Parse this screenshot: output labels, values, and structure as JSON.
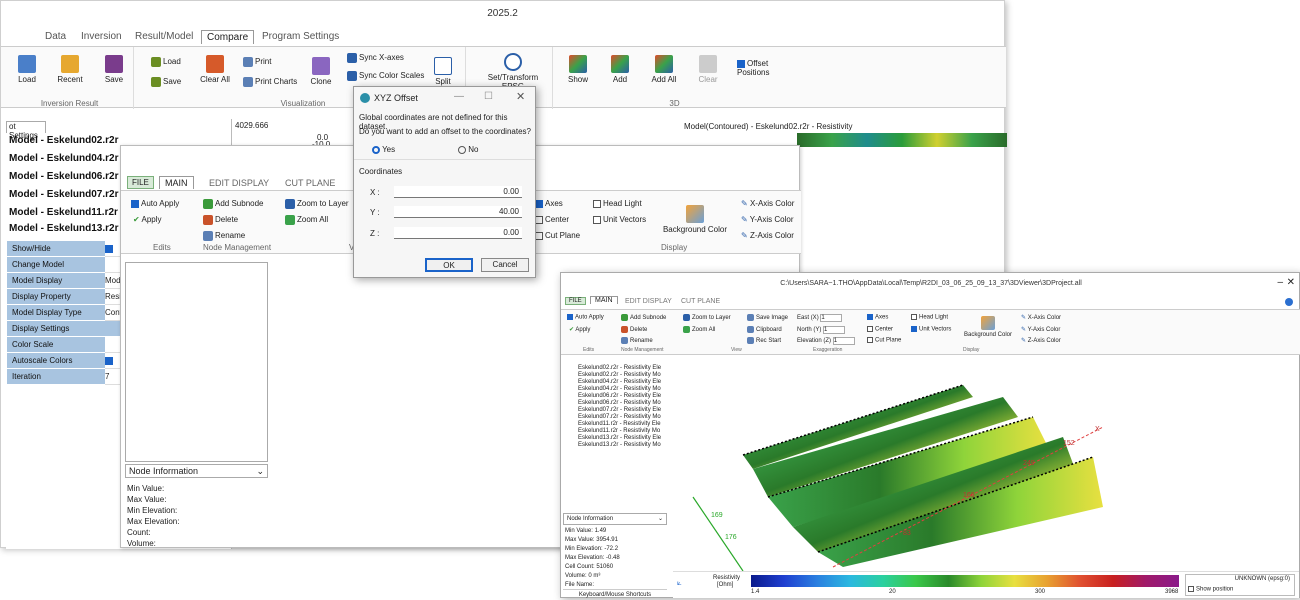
{
  "app": {
    "title": "2025.2"
  },
  "tabs": [
    "Data",
    "Inversion",
    "Result/Model",
    "Compare",
    "Program Settings"
  ],
  "ribbon": {
    "inversion_result": {
      "label": "Inversion Result",
      "load": "Load",
      "recent": "Recent",
      "save": "Save"
    },
    "visualization": {
      "label": "Visualization",
      "load": "Load",
      "save": "Save",
      "clear_all": "Clear All",
      "print": "Print",
      "print_charts": "Print Charts",
      "clone": "Clone",
      "sync_x": "Sync X-axes",
      "sync_color": "Sync Color Scales",
      "split": "Split"
    },
    "epsg": {
      "label": "Set/Transform EPSG"
    },
    "three_d": {
      "label": "3D",
      "show": "Show",
      "add": "Add",
      "add_all": "Add All",
      "clear": "Clear",
      "offset_positions": "Offset Positions"
    }
  },
  "plot": {
    "settings_tab": "ot Settings",
    "y_value": "4029.666",
    "y0": "0.0",
    "y1": "-10.0",
    "title": "Model(Contoured) - Eskelund02.r2r - Resistivity"
  },
  "models": [
    "Model - Eskelund02.r2r",
    "Model - Eskelund04.r2r",
    "Model - Eskelund06.r2r",
    "Model - Eskelund07.r2r",
    "Model - Eskelund11.r2r",
    "Model - Eskelund13.r2r"
  ],
  "properties": [
    {
      "name": "Show/Hide",
      "value": ""
    },
    {
      "name": "Change Model",
      "value": ""
    },
    {
      "name": "Model Display",
      "value": "Mod"
    },
    {
      "name": "Display Property",
      "value": "Resis"
    },
    {
      "name": "Model Display Type",
      "value": "Cont"
    },
    {
      "name": "Display Settings",
      "value": ""
    },
    {
      "name": "Color Scale",
      "value": ""
    },
    {
      "name": "Autoscale Colors",
      "value": ""
    },
    {
      "name": "Iteration",
      "value": "7"
    }
  ],
  "viewer1": {
    "tabs": [
      "FILE",
      "MAIN",
      "EDIT DISPLAY",
      "CUT PLANE"
    ],
    "auto_apply": "Auto Apply",
    "apply": "Apply",
    "edits": "Edits",
    "add_subnode": "Add Subnode",
    "delete": "Delete",
    "rename": "Rename",
    "node_mgmt": "Node Management",
    "zoom_layer": "Zoom to Layer",
    "zoom_all": "Zoom All",
    "view_short": "V",
    "axes": "Axes",
    "center": "Center",
    "cut_plane": "Cut Plane",
    "head_light": "Head Light",
    "unit_vectors": "Unit Vectors",
    "background_color": "Background Color",
    "display": "Display",
    "x_axis_color": "X-Axis Color",
    "y_axis_color": "Y-Axis Color",
    "z_axis_color": "Z-Axis Color",
    "node_info": "Node Information",
    "info": [
      "Min Value:",
      "Max Value:",
      "Min Elevation:",
      "Max Elevation:",
      "Count:",
      "Volume:"
    ]
  },
  "dialog": {
    "title": "XYZ Offset",
    "message1": "Global coordinates are not defined for this dataset.",
    "message2": "Do you want to add an offset to the coordinates?",
    "yes": "Yes",
    "no": "No",
    "coordinates": "Coordinates",
    "x_label": "X :",
    "y_label": "Y :",
    "z_label": "Z :",
    "x": "0.00",
    "y": "40.00",
    "z": "0.00",
    "ok": "OK",
    "cancel": "Cancel"
  },
  "viewer2": {
    "title": "C:\\Users\\SARA~1.THO\\AppData\\Local\\Temp\\R2DI_03_06_25_09_13_37\\3DViewer\\3DProject.all",
    "tabs": [
      "FILE",
      "MAIN",
      "EDIT DISPLAY",
      "CUT PLANE"
    ],
    "auto_apply": "Auto Apply",
    "apply": "Apply",
    "edits": "Edits",
    "add_subnode": "Add Subnode",
    "delete": "Delete",
    "rename": "Rename",
    "node_mgmt": "Node Management",
    "zoom_layer": "Zoom to Layer",
    "zoom_all": "Zoom All",
    "save_image": "Save Image",
    "clipboard": "Clipboard",
    "rec_start": "Rec Start",
    "view": "View",
    "east": "East",
    "north": "North",
    "elevation": "Elevation",
    "ex": "(X)",
    "ny": "(Y)",
    "ez": "(Z)",
    "one": "1",
    "exaggeration": "Exaggeration",
    "axes": "Axes",
    "center": "Center",
    "cut_plane": "Cut Plane",
    "head_light": "Head Light",
    "unit_vectors": "Unit Vectors",
    "background_color": "Background Color",
    "display": "Display",
    "x_axis_color": "X-Axis Color",
    "y_axis_color": "Y-Axis Color",
    "z_axis_color": "Z-Axis Color",
    "tree": [
      "Eskelund02.r2r - Resistivity Ele",
      "Eskelund02.r2r - Resistivity Mo",
      "Eskelund04.r2r - Resistivity Ele",
      "Eskelund04.r2r - Resistivity Mo",
      "Eskelund06.r2r - Resistivity Ele",
      "Eskelund06.r2r - Resistivity Mo",
      "Eskelund07.r2r - Resistivity Ele",
      "Eskelund07.r2r - Resistivity Mo",
      "Eskelund11.r2r - Resistivity Ele",
      "Eskelund11.r2r - Resistivity Mo",
      "Eskelund13.r2r - Resistivity Ele",
      "Eskelund13.r2r - Resistivity Mo"
    ],
    "node_info": "Node Information",
    "info": [
      "Min Value: 1.49",
      "Max Value: 3954.91",
      "Min Elevation: -72.2",
      "Max Elevation: -0.48",
      "Cell Count: 51060",
      "Volume: 0 m³",
      "File Name:"
    ],
    "shortcuts": "Keyboard/Mouse Shortcuts",
    "axis_labels": [
      "152",
      "249",
      "166",
      "83",
      "169",
      "176"
    ],
    "x_axis": "X",
    "legend_title": "Resistivity",
    "legend_unit": "[Ohm]",
    "legend_ticks": [
      "1.4",
      "20",
      "300",
      "3968"
    ],
    "crs": "UNKNOWN (epsg:0)",
    "show_position": "Show position"
  },
  "colors": {
    "ribbon_blue": "#1a63c9",
    "prop_bg": "#a8c4e0",
    "file_tab": "#5b9f5b"
  }
}
